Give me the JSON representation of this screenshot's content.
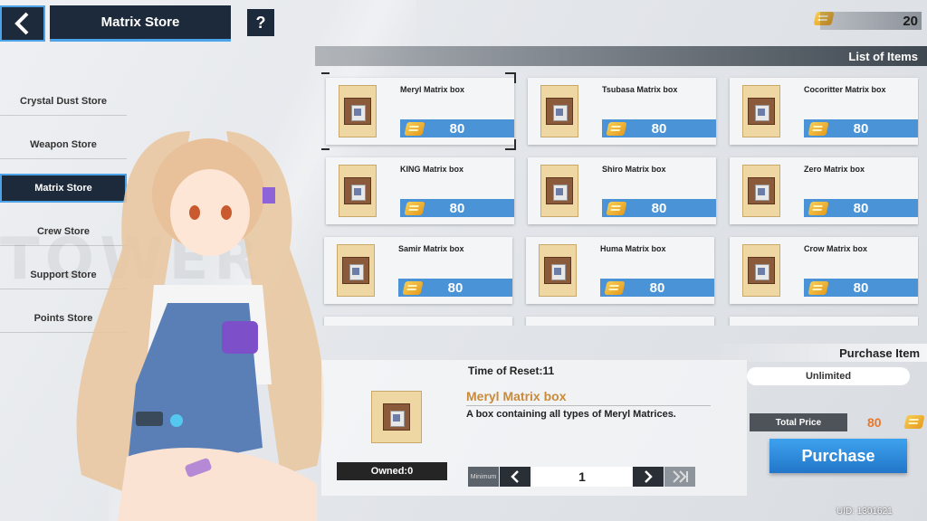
{
  "header": {
    "title": "Matrix Store",
    "help_label": "?",
    "currency_amount": "20"
  },
  "sidebar": {
    "items": [
      {
        "label": "Crystal Dust Store",
        "active": false
      },
      {
        "label": "Weapon Store",
        "active": false
      },
      {
        "label": "Matrix Store",
        "active": true
      },
      {
        "label": "Crew Store",
        "active": false
      },
      {
        "label": "Support Store",
        "active": false
      },
      {
        "label": "Points Store",
        "active": false
      }
    ]
  },
  "list": {
    "title": "List of Items",
    "items": [
      {
        "name": "Meryl Matrix box",
        "price": "80"
      },
      {
        "name": "Tsubasa Matrix box",
        "price": "80"
      },
      {
        "name": "Cocoritter Matrix box",
        "price": "80"
      },
      {
        "name": "KING Matrix box",
        "price": "80"
      },
      {
        "name": "Shiro Matrix box",
        "price": "80"
      },
      {
        "name": "Zero Matrix box",
        "price": "80"
      },
      {
        "name": "Samir Matrix box",
        "price": "80"
      },
      {
        "name": "Huma Matrix box",
        "price": "80"
      },
      {
        "name": "Crow Matrix box",
        "price": "80"
      }
    ]
  },
  "purchase": {
    "title": "Purchase Item",
    "reset_time": "Time of Reset:11",
    "item_name": "Meryl Matrix box",
    "item_desc": "A box containing all types of Meryl Matrices.",
    "owned": "Owned:0",
    "limit": "Unlimited",
    "total_label": "Total Price",
    "total_value": "80",
    "quantity": "1",
    "min_label": "Minimum",
    "purchase_label": "Purchase"
  },
  "footer": {
    "uid": "UID: 1301621"
  },
  "colors": {
    "accent": "#4da3e8",
    "price_bar": "#4a93d6",
    "dark": "#1c2a3b",
    "highlight": "#c98a3a"
  }
}
